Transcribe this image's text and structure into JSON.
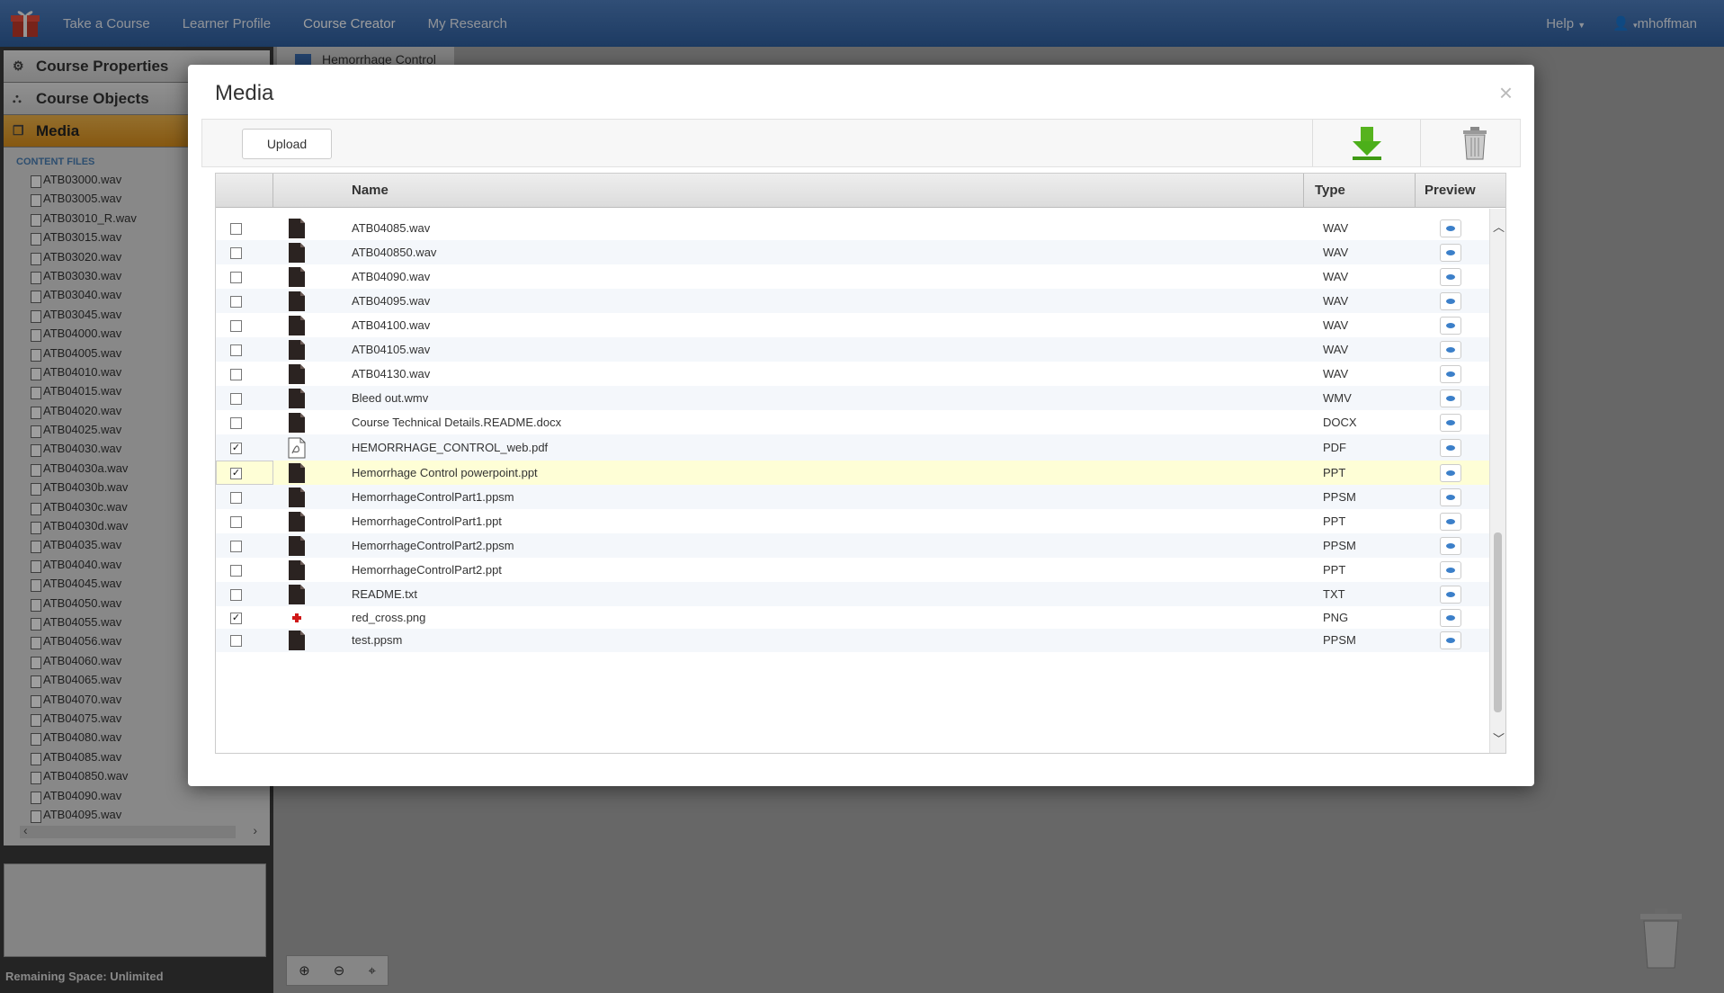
{
  "nav": {
    "links": [
      "Take a Course",
      "Learner Profile",
      "Course Creator",
      "My Research"
    ],
    "help": "Help",
    "user": "mhoffman"
  },
  "sidebar": {
    "sections": [
      "Course Properties",
      "Course Objects",
      "Media"
    ],
    "caption": "CONTENT FILES",
    "files": [
      "ATB03000.wav",
      "ATB03005.wav",
      "ATB03010_R.wav",
      "ATB03015.wav",
      "ATB03020.wav",
      "ATB03030.wav",
      "ATB03040.wav",
      "ATB03045.wav",
      "ATB04000.wav",
      "ATB04005.wav",
      "ATB04010.wav",
      "ATB04015.wav",
      "ATB04020.wav",
      "ATB04025.wav",
      "ATB04030.wav",
      "ATB04030a.wav",
      "ATB04030b.wav",
      "ATB04030c.wav",
      "ATB04030d.wav",
      "ATB04035.wav",
      "ATB04040.wav",
      "ATB04045.wav",
      "ATB04050.wav",
      "ATB04055.wav",
      "ATB04056.wav",
      "ATB04060.wav",
      "ATB04065.wav",
      "ATB04070.wav",
      "ATB04075.wav",
      "ATB04080.wav",
      "ATB04085.wav",
      "ATB040850.wav",
      "ATB04090.wav",
      "ATB04095.wav"
    ],
    "remaining": "Remaining Space: Unlimited"
  },
  "background_title": "Hemorrhage Control",
  "modal": {
    "title": "Media",
    "close": "×",
    "upload_label": "Upload",
    "columns": {
      "name": "Name",
      "type": "Type",
      "preview": "Preview"
    },
    "rows": [
      {
        "name": "ATB04085.wav",
        "type": "WAV",
        "checked": false,
        "icon": "file-icon"
      },
      {
        "name": "ATB040850.wav",
        "type": "WAV",
        "checked": false,
        "icon": "file-icon"
      },
      {
        "name": "ATB04090.wav",
        "type": "WAV",
        "checked": false,
        "icon": "file-icon"
      },
      {
        "name": "ATB04095.wav",
        "type": "WAV",
        "checked": false,
        "icon": "file-icon"
      },
      {
        "name": "ATB04100.wav",
        "type": "WAV",
        "checked": false,
        "icon": "file-icon"
      },
      {
        "name": "ATB04105.wav",
        "type": "WAV",
        "checked": false,
        "icon": "file-icon"
      },
      {
        "name": "ATB04130.wav",
        "type": "WAV",
        "checked": false,
        "icon": "file-icon"
      },
      {
        "name": "Bleed out.wmv",
        "type": "WMV",
        "checked": false,
        "icon": "file-icon"
      },
      {
        "name": "Course Technical Details.README.docx",
        "type": "DOCX",
        "checked": false,
        "icon": "file-icon"
      },
      {
        "name": "HEMORRHAGE_CONTROL_web.pdf",
        "type": "PDF",
        "checked": true,
        "icon": "pdf-icon"
      },
      {
        "name": "Hemorrhage Control powerpoint.ppt",
        "type": "PPT",
        "checked": true,
        "icon": "file-icon",
        "selected": true
      },
      {
        "name": "HemorrhageControlPart1.ppsm",
        "type": "PPSM",
        "checked": false,
        "icon": "file-icon"
      },
      {
        "name": "HemorrhageControlPart1.ppt",
        "type": "PPT",
        "checked": false,
        "icon": "file-icon"
      },
      {
        "name": "HemorrhageControlPart2.ppsm",
        "type": "PPSM",
        "checked": false,
        "icon": "file-icon"
      },
      {
        "name": "HemorrhageControlPart2.ppt",
        "type": "PPT",
        "checked": false,
        "icon": "file-icon"
      },
      {
        "name": "README.txt",
        "type": "TXT",
        "checked": false,
        "icon": "file-icon"
      },
      {
        "name": "red_cross.png",
        "type": "PNG",
        "checked": true,
        "icon": "red-cross-icon"
      },
      {
        "name": "test.ppsm",
        "type": "PPSM",
        "checked": false,
        "icon": "file-icon"
      }
    ]
  },
  "colors": {
    "navbar": "#3a6aae",
    "media_tab": "#e3a030",
    "selected_row": "#fefed6",
    "download_arrow": "#4caf1a"
  }
}
